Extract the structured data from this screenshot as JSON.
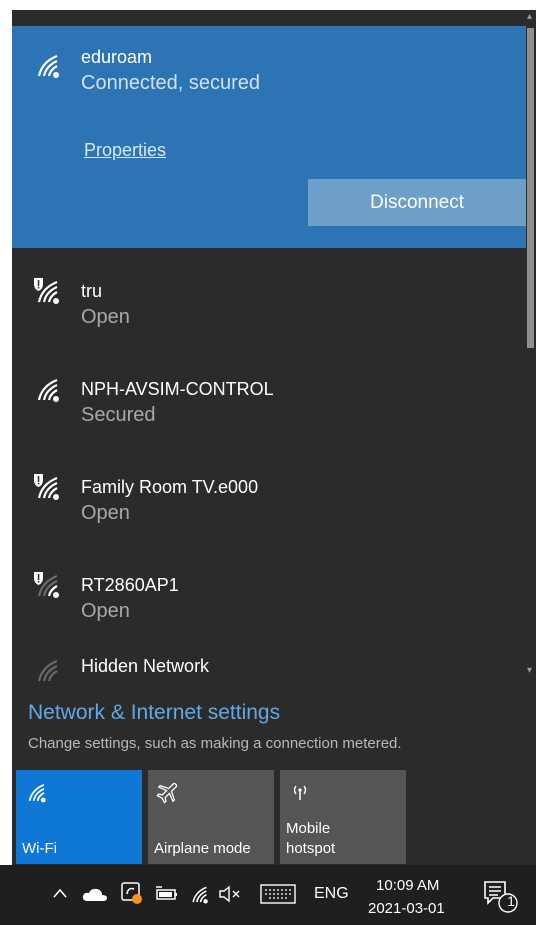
{
  "networks": {
    "connected": {
      "name": "eduroam",
      "status": "Connected, secured",
      "properties_label": "Properties",
      "disconnect_label": "Disconnect"
    },
    "list": [
      {
        "name": "tru",
        "status": "Open",
        "shield": true,
        "signal": "strong"
      },
      {
        "name": "NPH-AVSIM-CONTROL",
        "status": "Secured",
        "shield": false,
        "signal": "strong"
      },
      {
        "name": "Family Room TV.e000",
        "status": "Open",
        "shield": true,
        "signal": "strong"
      },
      {
        "name": "RT2860AP1",
        "status": "Open",
        "shield": true,
        "signal": "weak"
      },
      {
        "name": "Hidden Network",
        "status": "",
        "shield": false,
        "signal": "weak"
      }
    ]
  },
  "settings": {
    "link": "Network & Internet settings",
    "description": "Change settings, such as making a connection metered."
  },
  "quick_actions": [
    {
      "label": "Wi-Fi",
      "icon": "wifi-icon",
      "active": true
    },
    {
      "label": "Airplane mode",
      "icon": "airplane-icon",
      "active": false
    },
    {
      "label": "Mobile\nhotspot",
      "icon": "hotspot-icon",
      "active": false
    }
  ],
  "taskbar": {
    "language": "ENG",
    "time": "10:09 AM",
    "date": "2021-03-01",
    "notification_count": "1"
  },
  "colors": {
    "accent": "#2c74b4",
    "tile_active": "#0f78d6",
    "tile_inactive": "#555555",
    "panel": "#2b2b2b"
  }
}
